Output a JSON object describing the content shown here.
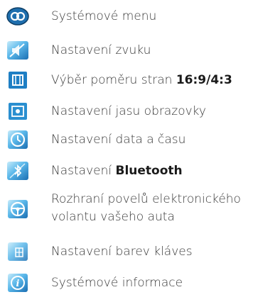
{
  "colors": {
    "icon_blue_light": "#8fd3f5",
    "icon_blue_dark": "#1b6fb3",
    "text": "#3a3a3a"
  },
  "items": [
    {
      "icon": "system-menu-icon",
      "label": "Systémové menu",
      "bold": ""
    },
    {
      "icon": "sound-settings-icon",
      "label": "Nastavení zvuku",
      "bold": ""
    },
    {
      "icon": "aspect-ratio-icon",
      "label": "Výběr poměru stran ",
      "bold": "16:9/4:3"
    },
    {
      "icon": "brightness-icon",
      "label": "Nastavení jasu obrazovky",
      "bold": ""
    },
    {
      "icon": "clock-icon",
      "label": "Nastavení data a času",
      "bold": ""
    },
    {
      "icon": "bluetooth-icon",
      "label": "Nastavení ",
      "bold": "Bluetooth"
    },
    {
      "icon": "steering-wheel-icon",
      "label": "Rozhraní povelů elektronického",
      "label2": "volantu vašeho auta",
      "bold": ""
    },
    {
      "icon": "key-color-icon",
      "label": "Nastavení barev kláves",
      "bold": ""
    },
    {
      "icon": "info-icon",
      "label": "Systémové informace",
      "bold": ""
    }
  ]
}
